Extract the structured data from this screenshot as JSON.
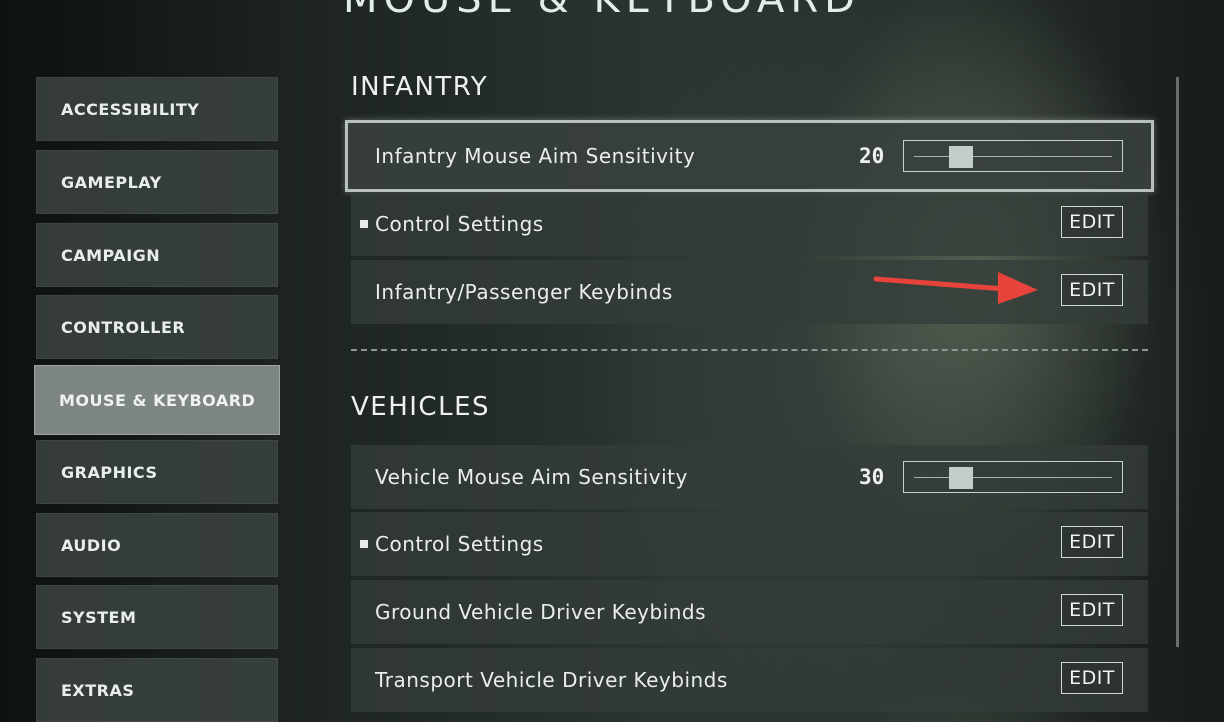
{
  "page_title": "MOUSE & KEYBOARD",
  "sidebar": {
    "items": [
      {
        "label": "ACCESSIBILITY"
      },
      {
        "label": "GAMEPLAY"
      },
      {
        "label": "CAMPAIGN"
      },
      {
        "label": "CONTROLLER"
      },
      {
        "label": "MOUSE & KEYBOARD",
        "active": true
      },
      {
        "label": "GRAPHICS"
      },
      {
        "label": "AUDIO"
      },
      {
        "label": "SYSTEM"
      },
      {
        "label": "EXTRAS"
      }
    ]
  },
  "infantry": {
    "title": "INFANTRY",
    "aim_sensitivity": {
      "label": "Infantry Mouse Aim Sensitivity",
      "value": "20",
      "slider_fraction": 0.2
    },
    "control_settings": {
      "label": "Control Settings",
      "button": "EDIT"
    },
    "keybinds": {
      "label": "Infantry/Passenger Keybinds",
      "button": "EDIT"
    }
  },
  "vehicles": {
    "title": "VEHICLES",
    "aim_sensitivity": {
      "label": "Vehicle Mouse Aim Sensitivity",
      "value": "30",
      "slider_fraction": 0.2
    },
    "control_settings": {
      "label": "Control Settings",
      "button": "EDIT"
    },
    "ground_keybinds": {
      "label": "Ground Vehicle Driver Keybinds",
      "button": "EDIT"
    },
    "transport_keybinds": {
      "label": "Transport Vehicle Driver Keybinds",
      "button": "EDIT"
    }
  },
  "colors": {
    "accent_arrow": "#e8433a",
    "active_nav": "#7d8682"
  }
}
